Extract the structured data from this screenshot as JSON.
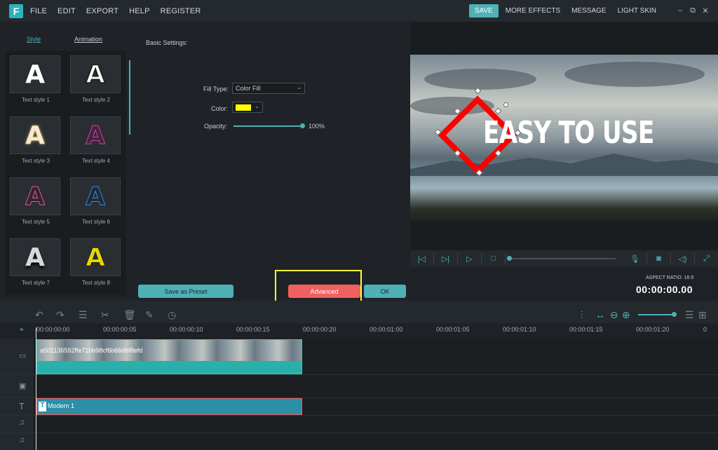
{
  "topbar": {
    "logo": "F",
    "menu": [
      "FILE",
      "EDIT",
      "EXPORT",
      "HELP",
      "REGISTER"
    ],
    "save": "SAVE",
    "links": [
      "MORE EFFECTS",
      "MESSAGE",
      "LIGHT SKIN"
    ],
    "window": [
      "–",
      "⧉",
      "✕"
    ]
  },
  "tabs": {
    "style": "Style",
    "animation": "Animation"
  },
  "styles": [
    {
      "label": "Text style 1",
      "color": "#ffffff"
    },
    {
      "label": "Text style 2",
      "color": "#ffffff"
    },
    {
      "label": "Text style 3",
      "color": "#f5ead0"
    },
    {
      "label": "Text style 4",
      "color": "#4a2040"
    },
    {
      "label": "Text style 5",
      "color": "#3a2030"
    },
    {
      "label": "Text style 6",
      "color": "#1a2a40"
    },
    {
      "label": "Text style 7",
      "color": "#d8d8d8"
    },
    {
      "label": "Text style 8",
      "color": "#e6d800"
    }
  ],
  "settings": {
    "heading": "Basic Settings:",
    "fill_type_label": "Fill Type:",
    "fill_type_value": "Color Fill",
    "color_label": "Color:",
    "color_value": "#ffff00",
    "opacity_label": "Opacity:",
    "opacity_value": "100%"
  },
  "buttons": {
    "save_preset": "Save as Preset",
    "advanced": "Advanced",
    "ok": "OK"
  },
  "preview": {
    "text": "EASY TO USE",
    "aspect": "ASPECT RATIO: 16:9",
    "timecode": "00:00:00.00"
  },
  "ruler": [
    "00:00:00:00",
    "00:00:00:05",
    "00:00:00:10",
    "00:00:00:15",
    "00:00:00:20",
    "00:00:01:00",
    "00:00:01:05",
    "00:00:01:10",
    "00:00:01:15",
    "00:00:01:20",
    "0"
  ],
  "clips": {
    "video": "a501136592ffe71bb98cf6b66dbf8efd",
    "text": "Modern 1"
  }
}
